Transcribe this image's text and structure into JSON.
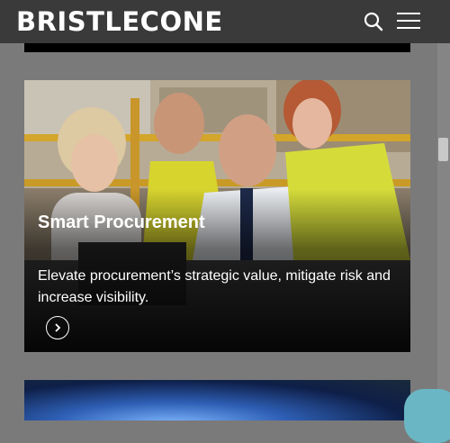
{
  "header": {
    "logo_text": "BRISTLECONE",
    "search_icon": "search-icon",
    "menu_icon": "hamburger-menu-icon"
  },
  "card": {
    "title": "Smart Procurement",
    "description": "Elevate procurement’s strategic value, mitigate risk and increase visibility.",
    "arrow_icon": "chevron-right-icon"
  },
  "colors": {
    "header_bg": "#3a3a3a",
    "page_bg": "#7a7a7a",
    "chat_button": "#6bb6c4"
  }
}
